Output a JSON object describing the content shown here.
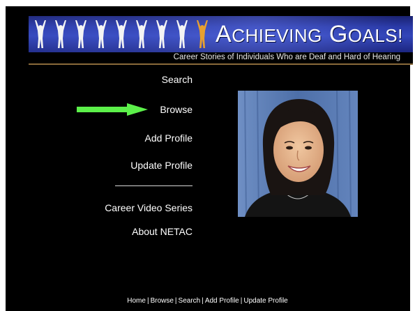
{
  "colors": {
    "page_background": "#000000",
    "outer_background": "#ffffff",
    "banner_blue": "#2a3aa8",
    "arrow_green": "#5cf04a",
    "highlight_figure": "#e8a030",
    "text": "#ffffff"
  },
  "banner": {
    "title_initial_1": "A",
    "title_rest_1": "CHIEVING",
    "title_initial_2": "G",
    "title_rest_2": "OALS!",
    "subtitle": "Career Stories of Individuals Who are Deaf and Hard of Hearing",
    "figure_icons": [
      "person-arms-raised-icon",
      "person-arms-raised-icon",
      "person-arms-raised-icon",
      "person-arms-raised-icon",
      "person-arms-raised-icon",
      "person-arms-raised-icon",
      "person-arms-raised-icon",
      "person-arms-raised-icon",
      "person-arms-raised-highlight-icon"
    ]
  },
  "nav": {
    "search": "Search",
    "browse": "Browse",
    "add_profile": "Add Profile",
    "update_profile": "Update Profile",
    "career_video_series": "Career Video Series",
    "about_netac": "About NETAC",
    "current_indicator_icon": "green-arrow-icon"
  },
  "footer": {
    "home": "Home",
    "browse": "Browse",
    "search": "Search",
    "add_profile": "Add Profile",
    "update_profile": "Update Profile",
    "separator": "|"
  }
}
